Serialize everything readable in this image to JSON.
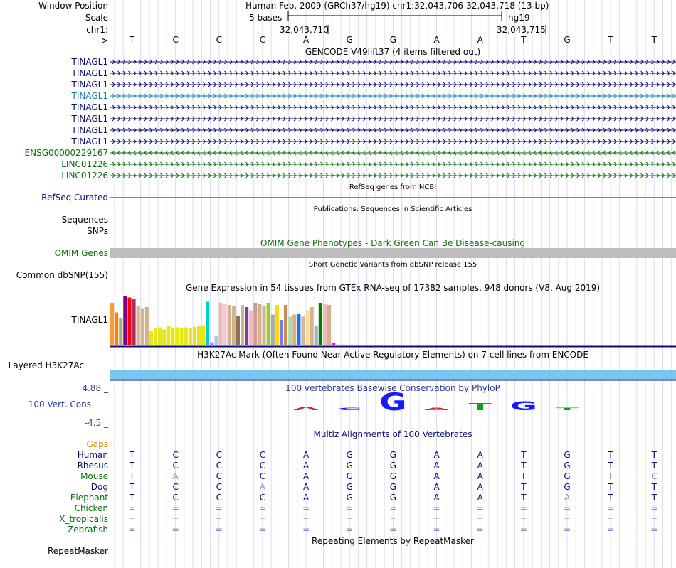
{
  "header": {
    "window_position_label": "Window Position",
    "window_position_value": "Human Feb. 2009 (GRCh37/hg19)   chr1:32,043,706-32,043,718 (13 bp)",
    "scale_label": "Scale",
    "scale_bases": "5 bases",
    "scale_assembly": "hg19",
    "chr_label": "chr1:",
    "coord_left": "32,043,710",
    "coord_right": "32,043,715",
    "strand_label": "--->"
  },
  "bases": [
    "T",
    "C",
    "C",
    "C",
    "A",
    "G",
    "G",
    "A",
    "A",
    "T",
    "G",
    "T",
    "T"
  ],
  "gencode": {
    "title": "GENCODE V49lift37 (4 items filtered out)",
    "rows": [
      {
        "label": "TINAGL1",
        "color": "#0c0c78",
        "dir": ">"
      },
      {
        "label": "TINAGL1",
        "color": "#0c0c78",
        "dir": ">"
      },
      {
        "label": "TINAGL1",
        "color": "#0c0c78",
        "dir": ">"
      },
      {
        "label": "TINAGL1",
        "color": "#1a7fa8",
        "dir": ">"
      },
      {
        "label": "TINAGL1",
        "color": "#0c0c78",
        "dir": ">"
      },
      {
        "label": "TINAGL1",
        "color": "#0c0c78",
        "dir": ">"
      },
      {
        "label": "TINAGL1",
        "color": "#0c0c78",
        "dir": ">"
      },
      {
        "label": "TINAGL1",
        "color": "#0c0c78",
        "dir": ">"
      },
      {
        "label": "ENSG00000229167",
        "color": "#0c6e0c",
        "dir": "<"
      },
      {
        "label": "LINC01226",
        "color": "#0c6e0c",
        "dir": ">"
      },
      {
        "label": "LINC01226",
        "color": "#0c6e0c",
        "dir": ">"
      }
    ]
  },
  "refseq": {
    "title": "RefSeq genes from NCBI",
    "label": "RefSeq Curated",
    "color": "#0c0c78"
  },
  "publications": {
    "title": "Publications: Sequences in Scientific Articles",
    "label1": "Sequences",
    "label2": "SNPs"
  },
  "omim": {
    "title": "OMIM Gene Phenotypes - Dark Green Can Be Disease-causing",
    "label": "OMIM Genes",
    "color": "#0c6e0c",
    "bar_color": "#bdbdbd"
  },
  "dbsnp": {
    "title": "Short Genetic Variants from dbSNP release 155",
    "label": "Common dbSNP(155)"
  },
  "gtex": {
    "title": "Gene Expression in 54 tissues from GTEx RNA-seq of 17382 samples, 948 donors (V8, Aug 2019)",
    "label": "TINAGL1",
    "tissue_colors": [
      "#ff9b2f",
      "#ff7f00",
      "#99b97a",
      "#800080",
      "#ff0000",
      "#aa2e5e",
      "#d2b48c",
      "#d2b48c",
      "#d2b48c",
      "#e6e619",
      "#e6e619",
      "#e6e619",
      "#e6e619",
      "#e6e619",
      "#e6e619",
      "#e6e619",
      "#e6e619",
      "#e6e619",
      "#e6e619",
      "#e6e619",
      "#e6e619",
      "#e6e619",
      "#00cdcd",
      "#ff66ff",
      "#aaccdd",
      "#eebbbb",
      "#f7c8d8",
      "#d2b48c",
      "#d2b48c",
      "#8b7355",
      "#d2b48c",
      "#7b3f98",
      "#eebbbb",
      "#cd9b9b",
      "#d2b48c",
      "#d2b48c",
      "#99cc33",
      "#aaaaaa",
      "#ffd700",
      "#7777ff",
      "#cc8855",
      "#aaddaa",
      "#d2b48c",
      "#1f6ef0",
      "#cdb79e",
      "#ffdd99",
      "#d2b48c",
      "#a0b0c8",
      "#008000",
      "#eebbbb",
      "#d2b48c",
      "#ff00ff",
      "#eeeeee",
      "#cccccc"
    ],
    "tissue_values": [
      0.8,
      0.62,
      0.52,
      0.92,
      0.9,
      0.88,
      0.74,
      0.7,
      0.72,
      0.28,
      0.32,
      0.34,
      0.3,
      0.36,
      0.32,
      0.34,
      0.32,
      0.34,
      0.33,
      0.35,
      0.36,
      0.38,
      0.82,
      0.06,
      0.18,
      0.8,
      0.78,
      0.76,
      0.74,
      0.56,
      0.76,
      0.72,
      0.66,
      0.8,
      0.78,
      0.74,
      0.8,
      0.58,
      0.76,
      0.48,
      0.76,
      0.54,
      0.58,
      0.6,
      0.54,
      0.66,
      0.72,
      0.36,
      0.8,
      0.78,
      0.76,
      0.04,
      0.02,
      0.02
    ]
  },
  "h3k27ac": {
    "title": "H3K27Ac Mark (Often Found Near Active Regulatory Elements) on 7 cell lines from ENCODE",
    "label": "Layered H3K27Ac",
    "color": "#7ac6f2"
  },
  "conservation": {
    "title": "100 vertebrates Basewise Conservation by PhyloP",
    "label": "100 Vert. Cons",
    "ymax": "4.88 _",
    "ymin": "-4.5 _",
    "color": "#2f3a8f",
    "logo": [
      {
        "base": "A",
        "height": 0.2,
        "color": "#e02020"
      },
      {
        "base": "C",
        "height": 0.1,
        "color": "#1a1aff"
      },
      {
        "base": "G",
        "height": 1.0,
        "color": "#1a1aff"
      },
      {
        "base": "A",
        "height": 0.05,
        "color": "#e02020"
      },
      {
        "base": "T",
        "height": 0.4,
        "color": "#10a020"
      },
      {
        "base": "G",
        "height": 0.5,
        "color": "#1a1aff"
      },
      {
        "base": "T",
        "height": 0.05,
        "color": "#10a020"
      }
    ]
  },
  "multiz": {
    "title": "Multiz Alignments of 100 Vertebrates",
    "gaps_label": "Gaps",
    "species": [
      {
        "name": "Human",
        "color": "#0c0c78",
        "seq": [
          "T",
          "C",
          "C",
          "C",
          "A",
          "G",
          "G",
          "A",
          "A",
          "T",
          "G",
          "T",
          "T"
        ],
        "faint": []
      },
      {
        "name": "Rhesus",
        "color": "#0c0c78",
        "seq": [
          "T",
          "C",
          "C",
          "C",
          "A",
          "G",
          "G",
          "A",
          "A",
          "T",
          "G",
          "T",
          "T"
        ],
        "faint": []
      },
      {
        "name": "Mouse",
        "color": "#0c6e0c",
        "seq": [
          "T",
          "A",
          "C",
          "C",
          "A",
          "G",
          "G",
          "A",
          "A",
          "T",
          "G",
          "T",
          "C"
        ],
        "faint": [
          1,
          12
        ]
      },
      {
        "name": "Dog",
        "color": "#0c0c78",
        "seq": [
          "T",
          "C",
          "C",
          "A",
          "A",
          "G",
          "G",
          "A",
          "A",
          "T",
          "G",
          "T",
          "T"
        ],
        "faint": [
          3
        ]
      },
      {
        "name": "Elephant",
        "color": "#0c6e0c",
        "seq": [
          "T",
          "C",
          "C",
          "C",
          "A",
          "G",
          "G",
          "A",
          "A",
          "T",
          "A",
          "T",
          "T"
        ],
        "faint": [
          10
        ]
      },
      {
        "name": "Chicken",
        "color": "#0c6e0c",
        "seq": [
          "=",
          "=",
          "=",
          "=",
          "=",
          "=",
          "=",
          "=",
          "=",
          "=",
          "=",
          "=",
          "="
        ],
        "faint": "all"
      },
      {
        "name": "X_tropicalis",
        "color": "#0c6e0c",
        "seq": [
          "=",
          "=",
          "=",
          "=",
          "=",
          "=",
          "=",
          "=",
          "=",
          "=",
          "=",
          "=",
          "="
        ],
        "faint": "all"
      },
      {
        "name": "Zebrafish",
        "color": "#0c6e0c",
        "seq": [
          "=",
          "=",
          "=",
          "=",
          "=",
          "=",
          "=",
          "=",
          "=",
          "=",
          "=",
          "=",
          "="
        ],
        "faint": "all"
      }
    ]
  },
  "repeatmasker": {
    "title": "Repeating Elements by RepeatMasker",
    "label": "RepeatMasker"
  }
}
